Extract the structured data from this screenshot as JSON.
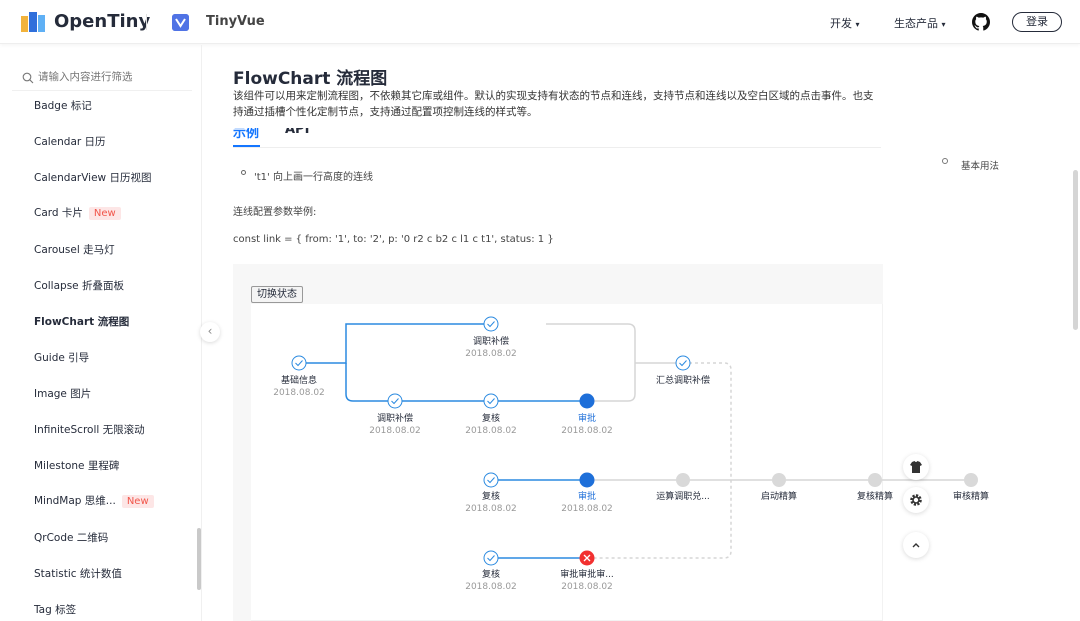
{
  "header": {
    "brand": "OpenTiny",
    "product": "TinyVue",
    "nav_dev": "开发",
    "nav_eco": "生态产品",
    "login": "登录",
    "colors": {
      "brand_blue": "#5073e5",
      "accent": "#1476ff"
    }
  },
  "sidebar": {
    "search_placeholder": "请输入内容进行筛选",
    "items": [
      {
        "label": "Badge 标记"
      },
      {
        "label": "Calendar 日历"
      },
      {
        "label": "CalendarView 日历视图"
      },
      {
        "label": "Card 卡片",
        "badge": "New"
      },
      {
        "label": "Carousel 走马灯"
      },
      {
        "label": "Collapse 折叠面板"
      },
      {
        "label": "FlowChart 流程图",
        "active": true
      },
      {
        "label": "Guide 引导"
      },
      {
        "label": "Image 图片"
      },
      {
        "label": "InfiniteScroll 无限滚动"
      },
      {
        "label": "Milestone 里程碑"
      },
      {
        "label": "MindMap 思维...",
        "badge": "New"
      },
      {
        "label": "QrCode 二维码"
      },
      {
        "label": "Statistic 统计数值"
      },
      {
        "label": "Tag 标签"
      }
    ]
  },
  "main": {
    "title": "FlowChart 流程图",
    "description": "该组件可以用来定制流程图，不依赖其它库或组件。默认的实现支持有状态的节点和连线，支持节点和连线以及空白区域的点击事件。也支持通过插槽个性化定制节点，支持通过配置项控制连线的样式等。",
    "tabs": [
      "示例",
      "API"
    ],
    "bullet_text": "'t1' 向上画一行高度的连线",
    "config_label": "连线配置参数举例:",
    "code_line": "const link = { from: '1', to: '2', p: '0 r2 c b2 c l1 c t1', status: 1 }",
    "switch_button": "切换状态"
  },
  "flow": {
    "nodes": [
      {
        "name": "基础信息",
        "date": "2018.08.02",
        "status": "done"
      },
      {
        "name": "调职补偿",
        "date": "2018.08.02",
        "status": "done"
      },
      {
        "name": "调职补偿",
        "date": "2018.08.02",
        "status": "done"
      },
      {
        "name": "复核",
        "date": "2018.08.02",
        "status": "done"
      },
      {
        "name": "审批",
        "date": "2018.08.02",
        "status": "ongoing"
      },
      {
        "name": "汇总调职补偿",
        "date": "",
        "status": "done"
      },
      {
        "name": "复核",
        "date": "2018.08.02",
        "status": "done"
      },
      {
        "name": "审批",
        "date": "2018.08.02",
        "status": "ongoing"
      },
      {
        "name": "运算调职兑...",
        "date": "",
        "status": "pending"
      },
      {
        "name": "启动精算",
        "date": "",
        "status": "pending"
      },
      {
        "name": "复核精算",
        "date": "",
        "status": "pending"
      },
      {
        "name": "审核精算",
        "date": "",
        "status": "pending"
      },
      {
        "name": "复核",
        "date": "2018.08.02",
        "status": "done"
      },
      {
        "name": "审批审批审...",
        "date": "2018.08.02",
        "status": "error"
      }
    ]
  },
  "aside": {
    "anchor": "基本用法"
  }
}
